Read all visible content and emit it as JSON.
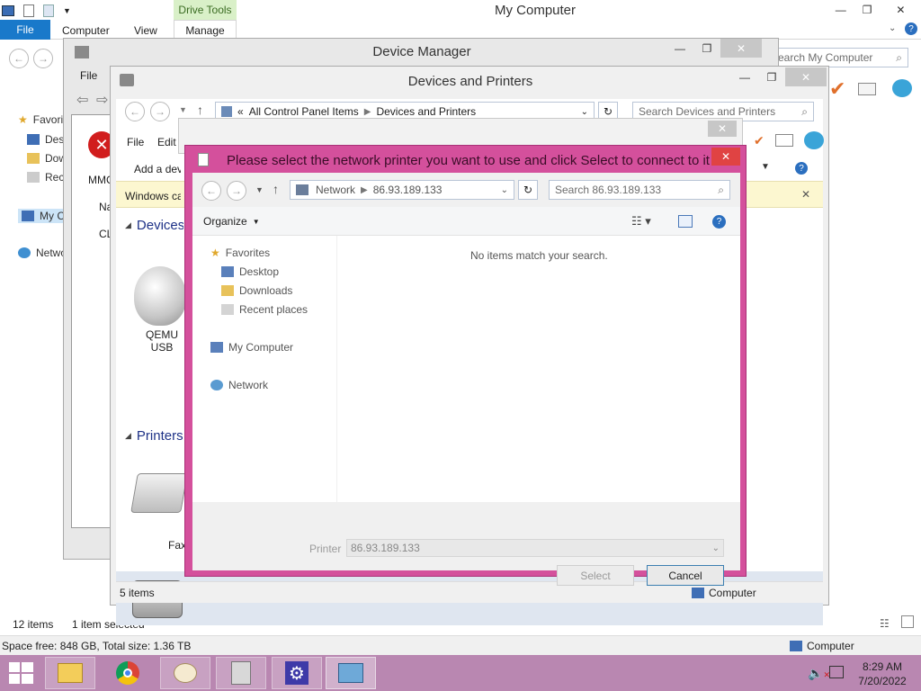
{
  "explorer": {
    "title": "My Computer",
    "drive_tools": "Drive Tools",
    "tabs": [
      "File",
      "Computer",
      "View",
      "Manage"
    ],
    "search_placeholder": "Search My Computer",
    "nav": {
      "favorites": "Favorites",
      "desktop": "Desktop",
      "downloads": "Downloads",
      "recent": "Recent places",
      "my_computer": "My Computer",
      "network": "Network"
    },
    "status_items": "12 items",
    "status_selected": "1 item selected",
    "details_bar": "Space free: 848 GB, Total size: 1.36 TB",
    "details_right": "Computer"
  },
  "device_manager": {
    "title": "Device Manager",
    "menu_file": "File",
    "mmc_text": "MMC",
    "na_text": "Na",
    "cl_text": "CL"
  },
  "devices_printers": {
    "title": "Devices and Printers",
    "breadcrumb": [
      "All Control Panel Items",
      "Devices and Printers"
    ],
    "search_placeholder": "Search Devices and Printers",
    "menu": [
      "File",
      "Edit"
    ],
    "add_device": "Add a device",
    "info_bar": "Windows can display enhanced device icons and information from the Internet. Click to change...",
    "section_devices": "Devices",
    "section_printers": "Printers",
    "device_label_1": "QEMU USB Tablet",
    "printer_label": "Fax",
    "status_items": "5 items",
    "status_right": "Computer"
  },
  "dialog": {
    "title": "Please select the network printer you want to use and click Select to connect to it",
    "breadcrumb": [
      "Network",
      "86.93.189.133"
    ],
    "search_placeholder": "Search 86.93.189.133",
    "organize": "Organize",
    "nav": {
      "favorites": "Favorites",
      "desktop": "Desktop",
      "downloads": "Downloads",
      "recent": "Recent places",
      "my_computer": "My Computer",
      "network": "Network"
    },
    "empty_message": "No items match your search.",
    "printer_label": "Printer",
    "printer_value": "86.93.189.133",
    "select_button": "Select",
    "cancel_button": "Cancel",
    "accent_color": "#d4509c"
  },
  "taskbar": {
    "time": "8:29 AM",
    "date": "7/20/2022",
    "color": "#b987b1"
  }
}
